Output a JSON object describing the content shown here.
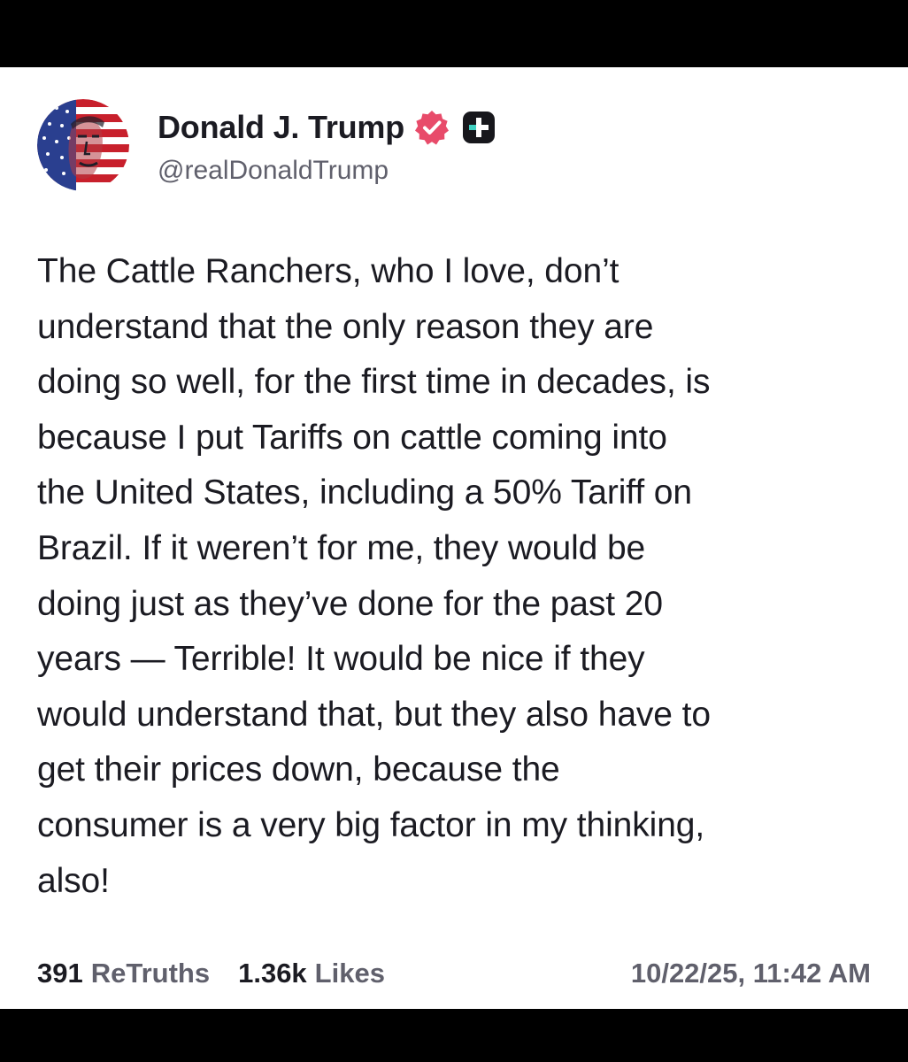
{
  "profile": {
    "display_name": "Donald J. Trump",
    "handle": "@realDonaldTrump",
    "verified_icon": "verified-badge-icon",
    "plus_icon": "plus-badge-icon"
  },
  "post": {
    "text": "The Cattle Ranchers, who I love, don’t\nunderstand that the only reason they are\ndoing so well, for the first time in decades, is\nbecause I put Tariffs on cattle coming into\nthe United States, including a 50% Tariff on\nBrazil. If it weren’t for me, they would be\ndoing just as they’ve done for the past 20\nyears — Terrible! It would be nice if they\nwould understand that, but they also have to\nget their prices down, because the\nconsumer is a very big factor in my thinking,\nalso!"
  },
  "stats": {
    "retruths_count": "391",
    "retruths_label": "ReTruths",
    "likes_count": "1.36k",
    "likes_label": "Likes",
    "timestamp": "10/22/25, 11:42 AM"
  },
  "colors": {
    "text_primary": "#1b1b22",
    "text_secondary": "#60606c",
    "verified_badge": "#e84b6a",
    "plus_badge_bg": "#17171c",
    "plus_badge_accent": "#3fd0c0"
  }
}
